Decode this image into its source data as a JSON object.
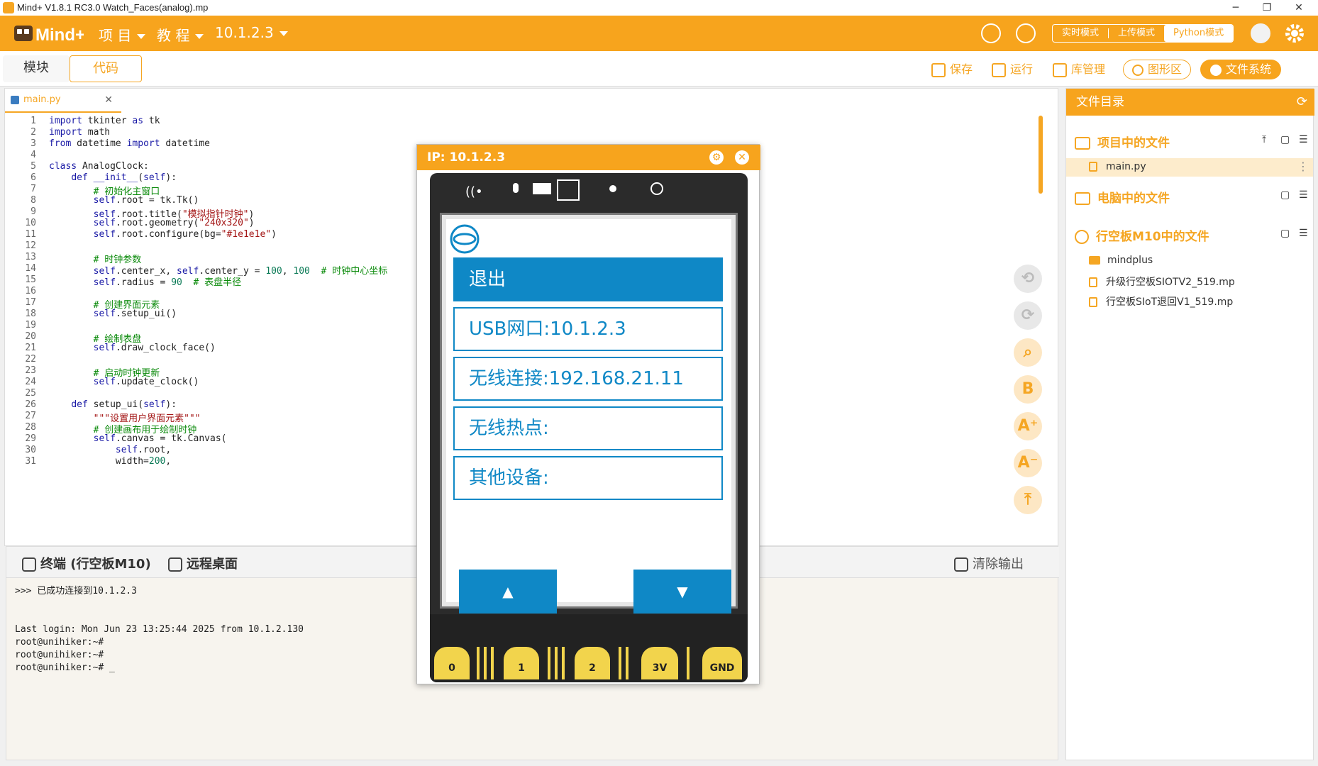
{
  "window": {
    "title": "Mind+ V1.8.1 RC3.0   Watch_Faces(analog).mp",
    "minimize": "─",
    "maximize": "❐",
    "close": "✕"
  },
  "menubar": {
    "logo": "Mind+",
    "menus": [
      "项 目",
      "教 程",
      "10.1.2.3"
    ],
    "modes": [
      "实时模式",
      "上传模式",
      "Python模式"
    ]
  },
  "toolbar": {
    "tab_blocks": "模块",
    "tab_code": "代码",
    "save": "保存",
    "run": "运行",
    "lib": "库管理",
    "graphic": "图形区",
    "filesystem": "文件系统"
  },
  "editor": {
    "file_tab": "main.py",
    "lines": [
      {
        "n": "1",
        "html": "<span class=\"kw\">import</span> tkinter <span class=\"kw\">as</span> tk"
      },
      {
        "n": "2",
        "html": "<span class=\"kw\">import</span> math"
      },
      {
        "n": "3",
        "html": "<span class=\"kw\">from</span> datetime <span class=\"kw\">import</span> datetime"
      },
      {
        "n": "4",
        "html": ""
      },
      {
        "n": "5",
        "html": "<span class=\"kw\">class</span> AnalogClock:"
      },
      {
        "n": "6",
        "html": "    <span class=\"kw\">def</span> <span class=\"sf\">__init__</span>(<span class=\"sf\">self</span>):"
      },
      {
        "n": "7",
        "html": "        <span class=\"cm\"># 初始化主窗口</span>"
      },
      {
        "n": "8",
        "html": "        <span class=\"sf\">self</span>.root = tk.Tk()"
      },
      {
        "n": "9",
        "html": "        <span class=\"sf\">self</span>.root.title(<span class=\"st\">\"模拟指针时钟\"</span>)"
      },
      {
        "n": "10",
        "html": "        <span class=\"sf\">self</span>.root.geometry(<span class=\"st\">\"240x320\"</span>)"
      },
      {
        "n": "11",
        "html": "        <span class=\"sf\">self</span>.root.configure(bg=<span class=\"st\">\"#1e1e1e\"</span>)"
      },
      {
        "n": "12",
        "html": ""
      },
      {
        "n": "13",
        "html": "        <span class=\"cm\"># 时钟参数</span>"
      },
      {
        "n": "14",
        "html": "        <span class=\"sf\">self</span>.center_x, <span class=\"sf\">self</span>.center_y = <span class=\"nm\">100</span>, <span class=\"nm\">100</span>  <span class=\"cm\"># 时钟中心坐标</span>"
      },
      {
        "n": "15",
        "html": "        <span class=\"sf\">self</span>.radius = <span class=\"nm\">90</span>  <span class=\"cm\"># 表盘半径</span>"
      },
      {
        "n": "16",
        "html": ""
      },
      {
        "n": "17",
        "html": "        <span class=\"cm\"># 创建界面元素</span>"
      },
      {
        "n": "18",
        "html": "        <span class=\"sf\">self</span>.setup_ui()"
      },
      {
        "n": "19",
        "html": ""
      },
      {
        "n": "20",
        "html": "        <span class=\"cm\"># 绘制表盘</span>"
      },
      {
        "n": "21",
        "html": "        <span class=\"sf\">self</span>.draw_clock_face()"
      },
      {
        "n": "22",
        "html": ""
      },
      {
        "n": "23",
        "html": "        <span class=\"cm\"># 启动时钟更新</span>"
      },
      {
        "n": "24",
        "html": "        <span class=\"sf\">self</span>.update_clock()"
      },
      {
        "n": "25",
        "html": ""
      },
      {
        "n": "26",
        "html": "    <span class=\"kw\">def</span> setup_ui(<span class=\"sf\">self</span>):"
      },
      {
        "n": "27",
        "html": "        <span class=\"st\">\"\"\"设置用户界面元素\"\"\"</span>"
      },
      {
        "n": "28",
        "html": "        <span class=\"cm\"># 创建画布用于绘制时钟</span>"
      },
      {
        "n": "29",
        "html": "        <span class=\"sf\">self</span>.canvas = tk.Canvas("
      },
      {
        "n": "30",
        "html": "            <span class=\"sf\">self</span>.root,"
      },
      {
        "n": "31",
        "html": "            width=<span class=\"nm\">200</span>,"
      }
    ]
  },
  "terminal": {
    "tab_terminal": "终端 (行空板M10)",
    "tab_remote": "远程桌面",
    "clear": "清除输出",
    "output": ">>> 已成功连接到10.1.2.3\n\n\nLast login: Mon Jun 23 13:25:44 2025 from 10.1.2.130\nroot@unihiker:~#\nroot@unihiker:~#\nroot@unihiker:~# _"
  },
  "filepanel": {
    "title": "文件目录",
    "sec_project": "项目中的文件",
    "project_files": [
      "main.py"
    ],
    "sec_pc": "电脑中的文件",
    "sec_board": "行空板M10中的文件",
    "board_folder": "mindplus",
    "board_files": [
      "升级行空板SIOTV2_519.mp",
      "行空板SIoT退回V1_519.mp"
    ]
  },
  "popup": {
    "title": "IP: 10.1.2.3",
    "menu": [
      "退出",
      "USB网口:10.1.2.3",
      "无线连接:192.168.21.11",
      "无线热点:",
      "其他设备:"
    ],
    "up": "▲",
    "down": "▼",
    "pins": [
      "0",
      "1",
      "2",
      "3V",
      "GND"
    ]
  },
  "colors": {
    "accent": "#f7a41d",
    "screen_blue": "#0f88c6"
  }
}
